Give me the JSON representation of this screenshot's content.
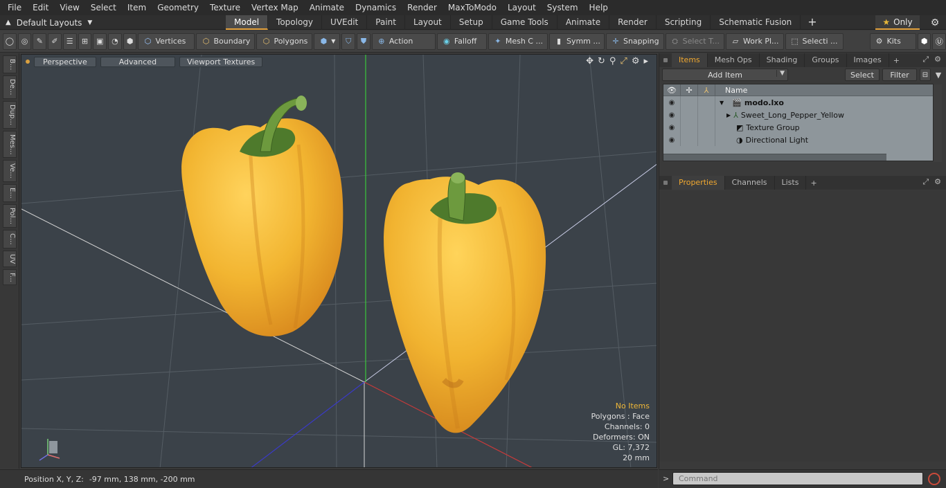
{
  "menu": [
    "File",
    "Edit",
    "View",
    "Select",
    "Item",
    "Geometry",
    "Texture",
    "Vertex Map",
    "Animate",
    "Dynamics",
    "Render",
    "MaxToModo",
    "Layout",
    "System",
    "Help"
  ],
  "layouts_label": "Default Layouts",
  "tabs": [
    {
      "label": "Model",
      "active": true
    },
    {
      "label": "Topology"
    },
    {
      "label": "UVEdit"
    },
    {
      "label": "Paint"
    },
    {
      "label": "Layout"
    },
    {
      "label": "Setup"
    },
    {
      "label": "Game Tools"
    },
    {
      "label": "Animate"
    },
    {
      "label": "Render"
    },
    {
      "label": "Scripting"
    },
    {
      "label": "Schematic Fusion"
    }
  ],
  "only_label": "Only",
  "toolbar": {
    "vertices": "Vertices",
    "boundary": "Boundary",
    "polygons": "Polygons",
    "action": "Action",
    "falloff": "Falloff",
    "mesh": "Mesh C ...",
    "symm": "Symm ...",
    "snapping": "Snapping",
    "select_t": "Select T...",
    "work_pl": "Work Pl...",
    "selecti": "Selecti ...",
    "kits": "Kits"
  },
  "side_tabs": [
    "B...",
    "De...",
    "Dup...",
    "Mes...",
    "Ve...",
    "E...",
    "Pol...",
    "C...",
    "UV",
    "F..."
  ],
  "viewport": {
    "perspective": "Perspective",
    "advanced": "Advanced",
    "viewport_textures": "Viewport Textures",
    "info": {
      "no_items": "No Items",
      "polygons": "Polygons : Face",
      "channels": "Channels: 0",
      "deformers": "Deformers: ON",
      "gl": "GL: 7,372",
      "scale": "20 mm"
    }
  },
  "items_tabs": [
    "Items",
    "Mesh Ops",
    "Shading",
    "Groups",
    "Images"
  ],
  "items_bar": {
    "add_item": "Add Item",
    "select": "Select",
    "filter": "Filter"
  },
  "tree": {
    "header_name": "Name",
    "rows": [
      {
        "label": "modo.lxo",
        "bold": true,
        "expander": "▼"
      },
      {
        "label": "Sweet_Long_Pepper_Yellow",
        "expander": "▶"
      },
      {
        "label": "Texture Group"
      },
      {
        "label": "Directional Light"
      }
    ]
  },
  "props_tabs": [
    "Properties",
    "Channels",
    "Lists"
  ],
  "status": {
    "position_label": "Position X, Y, Z:",
    "position_value": "-97 mm, 138 mm, -200 mm"
  },
  "command": {
    "prompt": ">",
    "placeholder": "Command"
  },
  "colors": {
    "accent": "#e3a03a",
    "pepper": "#f2b531",
    "stem": "#5a8a36",
    "viewport_bg": "#3b4249",
    "axis_x": "#c83a3a",
    "axis_y": "#3ac83a",
    "axis_z": "#3a3ac8"
  }
}
